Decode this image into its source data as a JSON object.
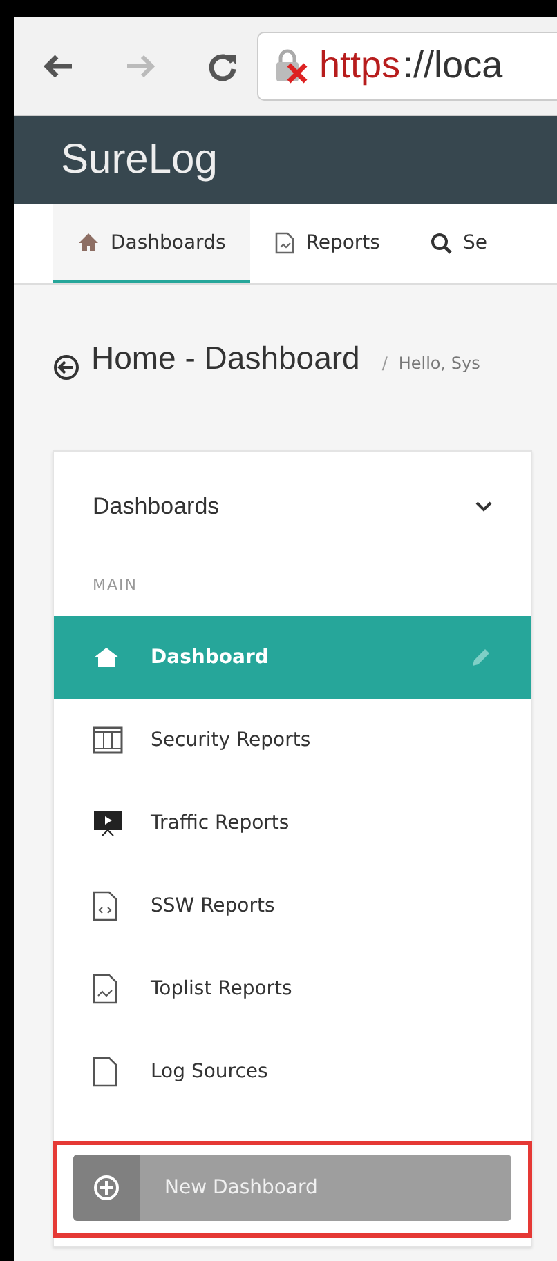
{
  "browser": {
    "url_scheme": "https",
    "url_rest": "://loca"
  },
  "app": {
    "logo": "SureLog"
  },
  "nav_tabs": [
    {
      "label": "Dashboards",
      "kind": "home",
      "selected": true
    },
    {
      "label": "Reports",
      "kind": "report",
      "selected": false
    },
    {
      "label": "Se",
      "kind": "search",
      "selected": false
    }
  ],
  "breadcrumb": {
    "title": "Home - Dashboard",
    "separator": "/",
    "greeting": "Hello, Sys"
  },
  "sidebar": {
    "title": "Dashboards",
    "section": "MAIN",
    "items": [
      {
        "label": "Dashboard",
        "kind": "home",
        "selected": true
      },
      {
        "label": "Security Reports",
        "kind": "film",
        "selected": false
      },
      {
        "label": "Traffic Reports",
        "kind": "monitor",
        "selected": false
      },
      {
        "label": "SSW Reports",
        "kind": "code",
        "selected": false
      },
      {
        "label": "Toplist Reports",
        "kind": "chart",
        "selected": false
      },
      {
        "label": "Log Sources",
        "kind": "file",
        "selected": false
      }
    ],
    "new_button": {
      "label": "New Dashboard",
      "highlighted": true
    }
  }
}
